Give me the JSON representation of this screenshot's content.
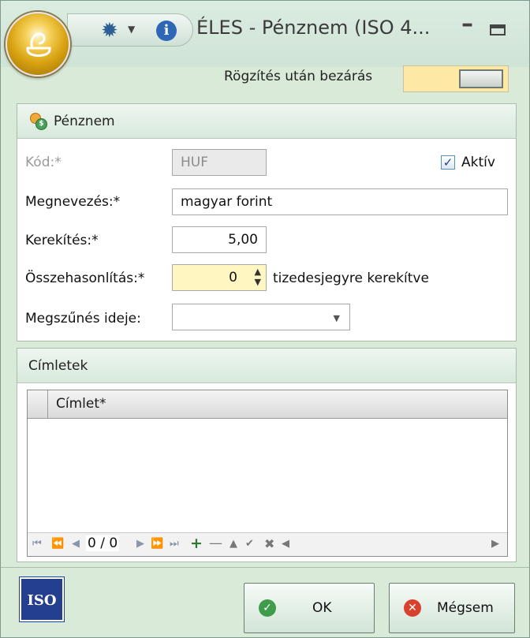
{
  "window": {
    "title": "ÉLES - Pénznem (ISO 4...",
    "minimize_glyph": "–"
  },
  "toolbar": {
    "close_after_save_label": "Rögzítés után bezárás"
  },
  "group_penznem": {
    "header": "Pénznem",
    "kod_label": "Kód:*",
    "kod_value": "HUF",
    "aktiv_label": "Aktív",
    "aktiv_checked": true,
    "megnevezes_label": "Megnevezés:*",
    "megnevezes_value": "magyar forint",
    "kerekites_label": "Kerekítés:*",
    "kerekites_value": "5,00",
    "osszehasonlitas_label": "Összehasonlítás:*",
    "osszehasonlitas_value": "0",
    "osszehasonlitas_suffix": "tizedesjegyre kerekítve",
    "megszunes_label": "Megszűnés ideje:",
    "megszunes_value": ""
  },
  "group_cimletek": {
    "header": "Címletek",
    "column_header": "Címlet*",
    "rows": [],
    "navigator_position": "0 / 0"
  },
  "buttons": {
    "ok_label": "OK",
    "cancel_label": "Mégsem",
    "iso_logo_text": "ISO"
  },
  "colors": {
    "window_bg": "#d9ead9",
    "toggle_bg": "#fde8a6",
    "focused_field": "#fff6c2",
    "ok_icon": "#3f9c4b",
    "cancel_icon": "#d9412f",
    "iso_blue": "#243f8f"
  }
}
